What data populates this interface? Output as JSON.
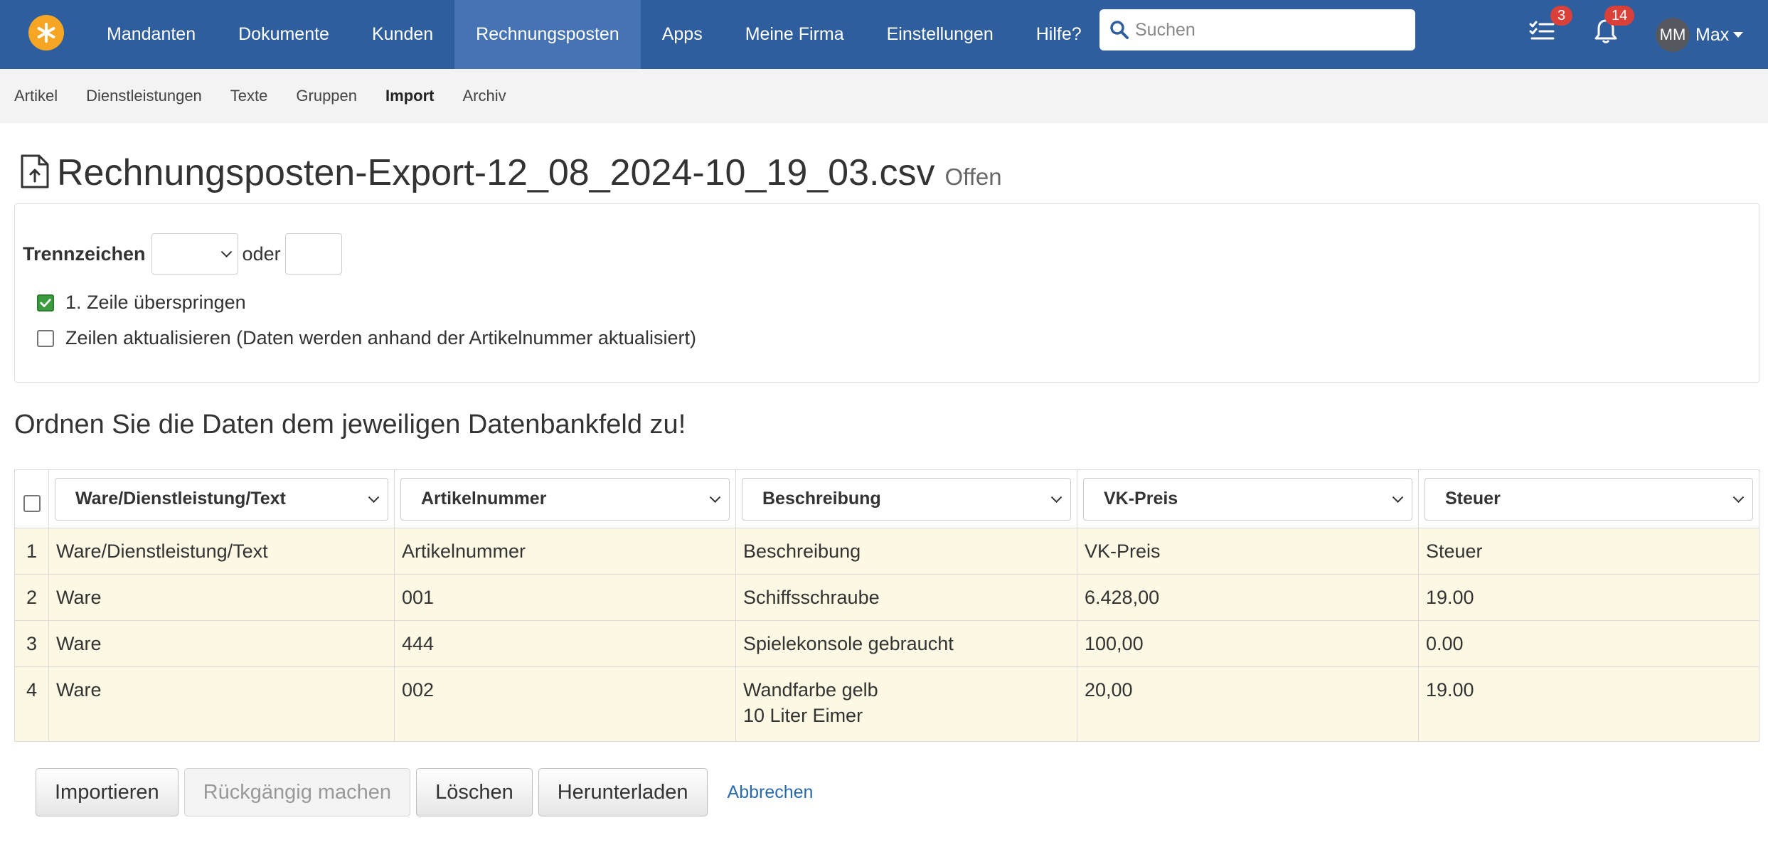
{
  "nav": {
    "items": [
      {
        "label": "Mandanten"
      },
      {
        "label": "Dokumente"
      },
      {
        "label": "Kunden"
      },
      {
        "label": "Rechnungsposten"
      },
      {
        "label": "Apps"
      },
      {
        "label": "Meine Firma"
      },
      {
        "label": "Einstellungen"
      },
      {
        "label": "Hilfe?"
      }
    ],
    "active_item": "Rechnungsposten",
    "search_placeholder": "Suchen",
    "tasks_badge": "3",
    "notifications_badge": "14",
    "user_initials": "MM",
    "user_name": "Max",
    "brand_color": "#2f5e9e",
    "logo_icon": "asterisk-icon"
  },
  "subnav": {
    "items": [
      {
        "label": "Artikel"
      },
      {
        "label": "Dienstleistungen"
      },
      {
        "label": "Texte"
      },
      {
        "label": "Gruppen"
      },
      {
        "label": "Import"
      },
      {
        "label": "Archiv"
      }
    ],
    "active_item": "Import"
  },
  "page": {
    "title": "Rechnungsposten-Export-12_08_2024-10_19_03.csv",
    "status": "Offen",
    "title_icon": "file-upload-icon"
  },
  "settings": {
    "separator_label": "Trennzeichen",
    "or_label": "oder",
    "skip_first_line_label": "1. Zeile überspringen",
    "skip_first_line_checked": true,
    "update_rows_label": "Zeilen aktualisieren (Daten werden anhand der Artikelnummer aktualisiert)",
    "update_rows_checked": false
  },
  "mapping": {
    "heading": "Ordnen Sie die Daten dem jeweiligen Datenbankfeld zu!",
    "columns": [
      {
        "field": "Ware/Dienstleistung/Text"
      },
      {
        "field": "Artikelnummer"
      },
      {
        "field": "Beschreibung"
      },
      {
        "field": "VK-Preis"
      },
      {
        "field": "Steuer"
      }
    ],
    "rows": [
      {
        "num": "1",
        "cells": [
          "Ware/Dienstleistung/Text",
          "Artikelnummer",
          "Beschreibung",
          "VK-Preis",
          "Steuer"
        ]
      },
      {
        "num": "2",
        "cells": [
          "Ware",
          "001",
          "Schiffsschraube",
          "6.428,00",
          "19.00"
        ]
      },
      {
        "num": "3",
        "cells": [
          "Ware",
          "444",
          "Spielekonsole gebraucht",
          "100,00",
          "0.00"
        ]
      },
      {
        "num": "4",
        "cells": [
          "Ware",
          "002",
          "Wandfarbe gelb\n10 Liter Eimer",
          "20,00",
          "19.00"
        ]
      }
    ]
  },
  "actions": {
    "import_label": "Importieren",
    "undo_label": "Rückgängig machen",
    "delete_label": "Löschen",
    "download_label": "Herunterladen",
    "cancel_label": "Abbrechen"
  }
}
